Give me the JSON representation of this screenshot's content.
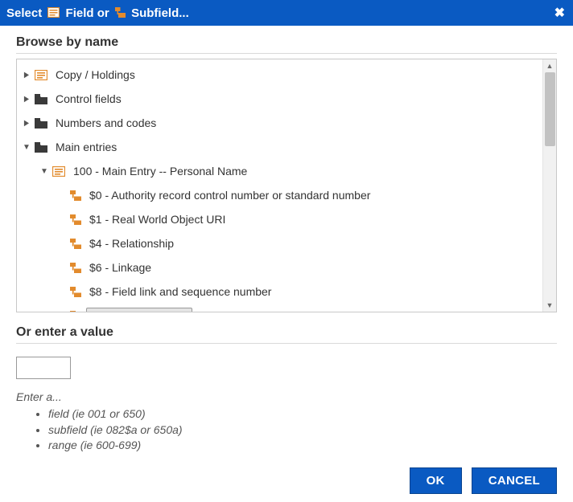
{
  "header": {
    "select_label": "Select",
    "field_label": "Field",
    "or_label": "or",
    "subfield_label": "Subfield...",
    "close_glyph": "✖"
  },
  "browse": {
    "title": "Browse by name",
    "tree": [
      {
        "id": "copy-holdings",
        "label": "Copy / Holdings",
        "icon": "field",
        "expanded": false,
        "children": true,
        "level": 0
      },
      {
        "id": "control-fields",
        "label": "Control fields",
        "icon": "folder",
        "expanded": false,
        "children": true,
        "level": 0
      },
      {
        "id": "numbers-codes",
        "label": "Numbers and codes",
        "icon": "folder",
        "expanded": false,
        "children": true,
        "level": 0
      },
      {
        "id": "main-entries",
        "label": "Main entries",
        "icon": "folder",
        "expanded": true,
        "children": true,
        "level": 0
      },
      {
        "id": "f100",
        "label": "100 - Main Entry -- Personal Name",
        "icon": "field",
        "expanded": true,
        "children": true,
        "level": 1
      },
      {
        "id": "f100-0",
        "label": "$0 - Authority record control number or standard number",
        "icon": "subfield",
        "expanded": false,
        "children": false,
        "level": 2
      },
      {
        "id": "f100-1",
        "label": "$1 - Real World Object URI",
        "icon": "subfield",
        "expanded": false,
        "children": false,
        "level": 2
      },
      {
        "id": "f100-4",
        "label": "$4 - Relationship",
        "icon": "subfield",
        "expanded": false,
        "children": false,
        "level": 2
      },
      {
        "id": "f100-6",
        "label": "$6 - Linkage",
        "icon": "subfield",
        "expanded": false,
        "children": false,
        "level": 2
      },
      {
        "id": "f100-8",
        "label": "$8 - Field link and sequence number",
        "icon": "subfield",
        "expanded": false,
        "children": false,
        "level": 2
      },
      {
        "id": "f100-a",
        "label": "$a - Personal name",
        "icon": "subfield",
        "expanded": false,
        "children": false,
        "level": 2,
        "selected": true
      }
    ]
  },
  "enter": {
    "title": "Or enter a value",
    "value": "",
    "placeholder": "",
    "hint_intro": "Enter a...",
    "hints": [
      "field (ie 001 or 650)",
      "subfield (ie 082$a or 650a)",
      "range (ie 600-699)"
    ]
  },
  "buttons": {
    "ok": "OK",
    "cancel": "CANCEL"
  },
  "colors": {
    "brand": "#0a5ac2",
    "icon_orange": "#e28b2d",
    "icon_dark": "#3a3a3a"
  }
}
